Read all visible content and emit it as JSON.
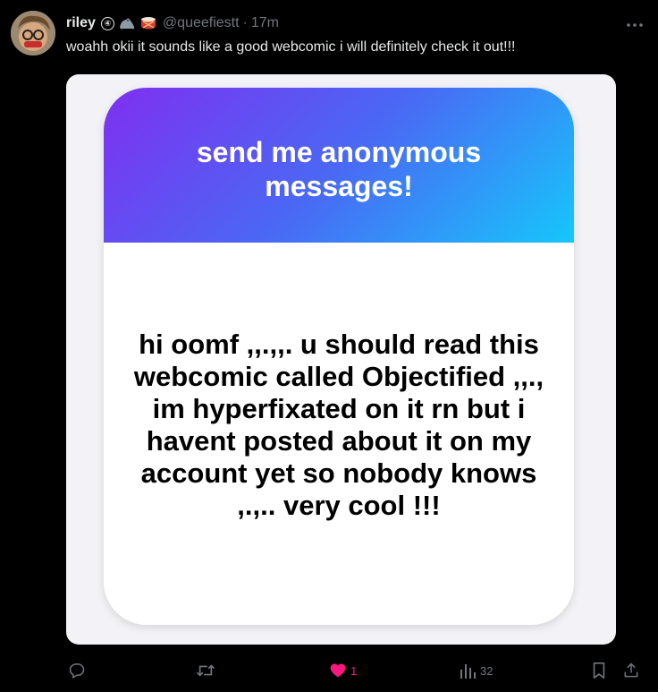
{
  "tweet": {
    "author_name": "riley",
    "badge_number": "④",
    "emoji_icons": [
      "seal-icon",
      "drum-icon"
    ],
    "handle": "@queefiestt",
    "separator": "·",
    "time": "17m",
    "text": "woahh okii it sounds like a good webcomic i will definitely check it out!!!"
  },
  "image_card": {
    "title": "send me anonymous messages!",
    "message": "hi oomf ,,.,,. u should read this webcomic called Objectified ,,., im hyperfixated on it rn but i havent posted about it on my account yet so nobody knows ,.,.. very cool !!!",
    "gradient_colors": [
      "#7f2ff0",
      "#4a68f4",
      "#16c7fb"
    ]
  },
  "actions": {
    "reply_icon": "reply-icon",
    "retweet_icon": "retweet-icon",
    "like_icon": "heart-icon",
    "like_count": "1",
    "like_color": "#f91880",
    "views_icon": "views-icon",
    "views_count": "32",
    "bookmark_icon": "bookmark-icon",
    "share_icon": "share-icon"
  },
  "more_icon": "more-icon"
}
